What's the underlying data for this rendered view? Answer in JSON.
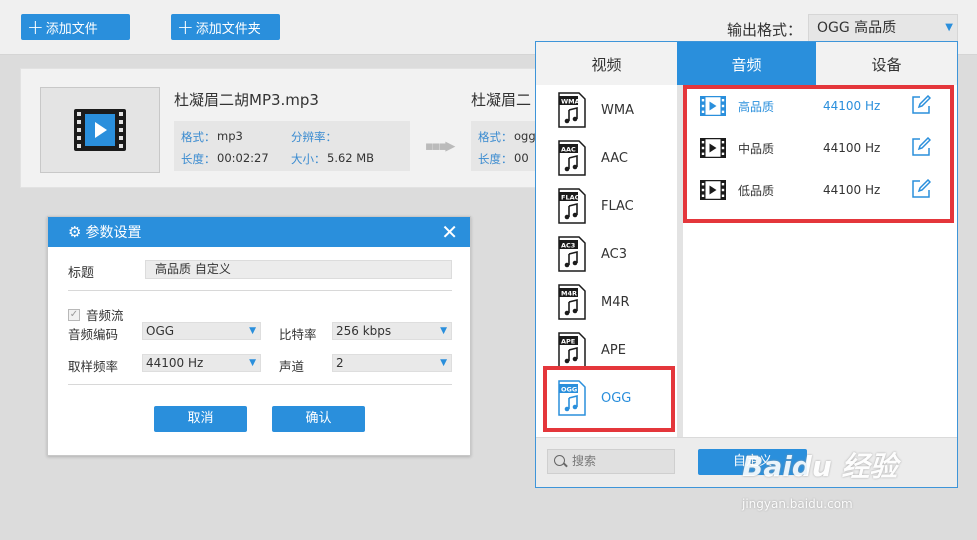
{
  "toolbar": {
    "add_file": "添加文件",
    "add_folder": "添加文件夹",
    "output_format_label": "输出格式：",
    "output_format_value": "OGG  高品质"
  },
  "file": {
    "name": "杜凝眉二胡MP3.mp3",
    "format_label": "格式：",
    "format_value": "mp3",
    "resolution_label": "分辨率：",
    "duration_label": "长度：",
    "duration_value": "00:02:27",
    "size_label": "大小：",
    "size_value": "5.62 MB",
    "output_name": "杜凝眉二",
    "output_format_label": "格式：",
    "output_format_value": "ogg",
    "output_duration_label": "长度：",
    "output_duration_value": "00"
  },
  "dialog": {
    "title": "参数设置",
    "title_label": "标题",
    "title_value": "高品质 自定义",
    "audio_stream": "音频流",
    "audio_codec_label": "音频编码",
    "audio_codec_value": "OGG",
    "bitrate_label": "比特率",
    "bitrate_value": "256 kbps",
    "sample_rate_label": "取样频率",
    "sample_rate_value": "44100 Hz",
    "channel_label": "声道",
    "channel_value": "2",
    "cancel": "取消",
    "confirm": "确认"
  },
  "format_panel": {
    "tabs": [
      "视频",
      "音频",
      "设备"
    ],
    "active_tab": 1,
    "formats": [
      {
        "name": "WMA",
        "badge": "WMA"
      },
      {
        "name": "AAC",
        "badge": "AAC"
      },
      {
        "name": "FLAC",
        "badge": "FLAC"
      },
      {
        "name": "AC3",
        "badge": "AC3"
      },
      {
        "name": "M4R",
        "badge": "M4R"
      },
      {
        "name": "APE",
        "badge": "APE"
      },
      {
        "name": "OGG",
        "badge": "OGG"
      }
    ],
    "selected_format": "OGG",
    "qualities": [
      {
        "name": "高品质",
        "hz": "44100 Hz",
        "active": true
      },
      {
        "name": "中品质",
        "hz": "44100 Hz",
        "active": false
      },
      {
        "name": "低品质",
        "hz": "44100 Hz",
        "active": false
      }
    ],
    "search_placeholder": "搜索",
    "custom_button": "自定义"
  },
  "watermark": {
    "line1": "Baidu 经验",
    "line2": "jingyan.baidu.com"
  },
  "colors": {
    "accent": "#2a8fdc",
    "highlight": "#e4363b"
  }
}
